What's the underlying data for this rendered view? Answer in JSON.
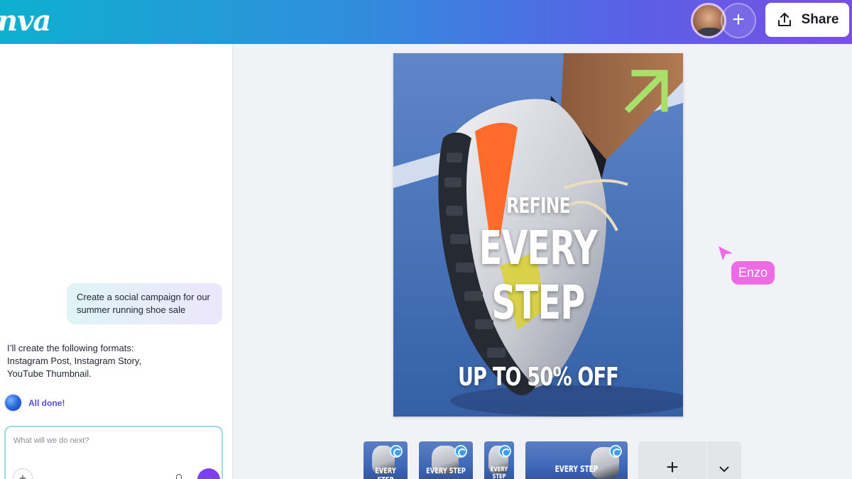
{
  "app": {
    "logo_text": "nva"
  },
  "header": {
    "share_label": "Share",
    "add_collaborator_icon": "plus-icon",
    "avatar_icon": "user-avatar"
  },
  "chat": {
    "user_message": "Create a social campaign for our summer running shoe sale",
    "ai_message_line1": "I’ll create the following formats:",
    "ai_message_line2": "Instagram Post, Instagram Story,",
    "ai_message_line3": "YouTube Thumbnail.",
    "status_label": "All done!",
    "prompt_placeholder": "What will we do next?",
    "prompt_value": ""
  },
  "design": {
    "headline_top": "REFINE",
    "headline_main": "EVERY STEP",
    "offer": "UP TO 50% OFF",
    "accent_color": "#a7e06a"
  },
  "collaborator": {
    "name": "Enzo",
    "color": "#ee6be6"
  },
  "pages": {
    "thumbnails": [
      {
        "label": "EVERY STEP"
      },
      {
        "label": "EVERY STEP"
      },
      {
        "label": "EVERY STEP"
      },
      {
        "label": "EVERY STEP"
      }
    ],
    "add_icon": "plus-icon",
    "expand_icon": "chevron-down-icon"
  }
}
